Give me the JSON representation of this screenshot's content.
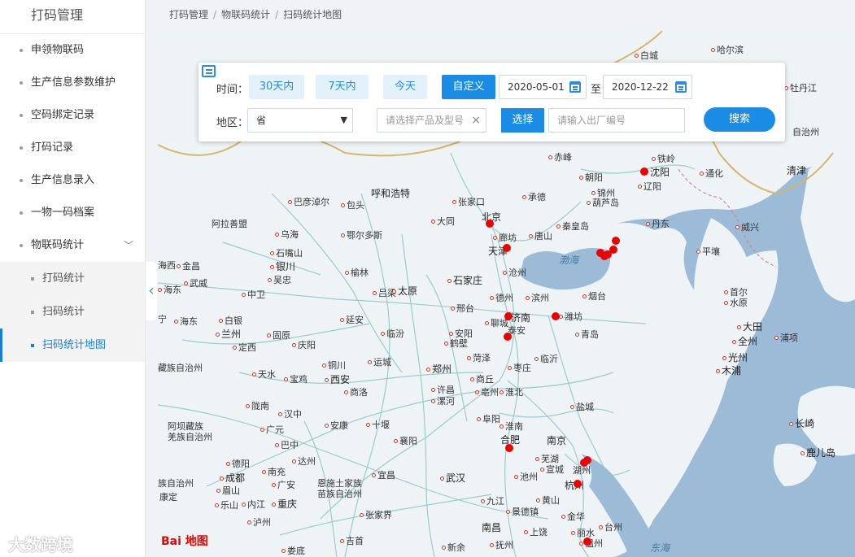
{
  "sidebar": {
    "title": "打码管理",
    "items": [
      {
        "label": "申领物联码"
      },
      {
        "label": "生产信息参数维护"
      },
      {
        "label": "空码绑定记录"
      },
      {
        "label": "打码记录"
      },
      {
        "label": "生产信息录入"
      },
      {
        "label": "一物一码档案"
      },
      {
        "label": "物联码统计"
      }
    ],
    "subitems": [
      {
        "label": "打码统计"
      },
      {
        "label": "扫码统计"
      },
      {
        "label": "扫码统计地图"
      }
    ],
    "collapse_icon": "chevron-left-icon"
  },
  "breadcrumb": [
    "打码管理",
    "物联码统计",
    "扫码统计地图"
  ],
  "breadcrumb_sep": "/",
  "filter": {
    "time_label": "时间：",
    "ranges": [
      "30天内",
      "7天内",
      "今天",
      "自定义"
    ],
    "active_range": "自定义",
    "start_date": "2020-05-01",
    "to_label": "至",
    "end_date": "2020-12-22",
    "region_label": "地区：",
    "region_value": "省",
    "product_placeholder": "请选择产品及型号",
    "select_button": "选择",
    "factory_placeholder": "请输入出厂编号",
    "search_button": "搜索"
  },
  "map": {
    "cities": [
      {
        "name": "白城"
      },
      {
        "name": "哈尔滨"
      },
      {
        "name": "牡丹江"
      },
      {
        "name": "自治州"
      },
      {
        "name": "赤峰"
      },
      {
        "name": "铁岭"
      },
      {
        "name": "沈阳"
      },
      {
        "name": "朝阳"
      },
      {
        "name": "通化"
      },
      {
        "name": "锦州"
      },
      {
        "name": "清津"
      },
      {
        "name": "辽阳"
      },
      {
        "name": "葫芦岛"
      },
      {
        "name": "承德"
      },
      {
        "name": "呼和浩特"
      },
      {
        "name": "巴彦淖尔"
      },
      {
        "name": "包头"
      },
      {
        "name": "张家口"
      },
      {
        "name": "北京"
      },
      {
        "name": "秦皇岛"
      },
      {
        "name": "丹东"
      },
      {
        "name": "威兴"
      },
      {
        "name": "大同"
      },
      {
        "name": "廊坊"
      },
      {
        "name": "唐山"
      },
      {
        "name": "阿拉善盟"
      },
      {
        "name": "乌海"
      },
      {
        "name": "鄂尔多斯"
      },
      {
        "name": "天津"
      },
      {
        "name": "平壤"
      },
      {
        "name": "石嘴山"
      },
      {
        "name": "金昌"
      },
      {
        "name": "银川"
      },
      {
        "name": "沧州"
      },
      {
        "name": "武威"
      },
      {
        "name": "吴忠"
      },
      {
        "name": "榆林"
      },
      {
        "name": "石家庄"
      },
      {
        "name": "首尔"
      },
      {
        "name": "中卫"
      },
      {
        "name": "吕梁"
      },
      {
        "name": "太原"
      },
      {
        "name": "德州"
      },
      {
        "name": "滨州"
      },
      {
        "name": "烟台"
      },
      {
        "name": "水原"
      },
      {
        "name": "海东"
      },
      {
        "name": "白银"
      },
      {
        "name": "延安"
      },
      {
        "name": "邢台"
      },
      {
        "name": "济南"
      },
      {
        "name": "潍坊"
      },
      {
        "name": "大田"
      },
      {
        "name": "兰州"
      },
      {
        "name": "固原"
      },
      {
        "name": "临汾"
      },
      {
        "name": "安阳"
      },
      {
        "name": "聊城"
      },
      {
        "name": "泰安"
      },
      {
        "name": "青岛"
      },
      {
        "name": "全州"
      },
      {
        "name": "浦项"
      },
      {
        "name": "定西"
      },
      {
        "name": "庆阳"
      },
      {
        "name": "鹤壁"
      },
      {
        "name": "光州"
      },
      {
        "name": "铜川"
      },
      {
        "name": "运城"
      },
      {
        "name": "菏泽"
      },
      {
        "name": "临沂"
      },
      {
        "name": "木浦"
      },
      {
        "name": "天水"
      },
      {
        "name": "宝鸡"
      },
      {
        "name": "西安"
      },
      {
        "name": "郑州"
      },
      {
        "name": "商丘"
      },
      {
        "name": "枣庄"
      },
      {
        "name": "陇南"
      },
      {
        "name": "商洛"
      },
      {
        "name": "许昌"
      },
      {
        "name": "亳州"
      },
      {
        "name": "淮北"
      },
      {
        "name": "盐城"
      },
      {
        "name": "汉中"
      },
      {
        "name": "漯河"
      },
      {
        "name": "阜阳"
      },
      {
        "name": "长崎"
      },
      {
        "name": "安康"
      },
      {
        "name": "十堰"
      },
      {
        "name": "淮南"
      },
      {
        "name": "广元"
      },
      {
        "name": "巴中"
      },
      {
        "name": "襄阳"
      },
      {
        "name": "合肥"
      },
      {
        "name": "南京"
      },
      {
        "name": "鹿儿岛"
      },
      {
        "name": "达州"
      },
      {
        "name": "德阳"
      },
      {
        "name": "芜湖"
      },
      {
        "name": "成都"
      },
      {
        "name": "南充"
      },
      {
        "name": "宜昌"
      },
      {
        "name": "武汉"
      },
      {
        "name": "宣城"
      },
      {
        "name": "湖州"
      },
      {
        "name": "池州"
      },
      {
        "name": "广安"
      },
      {
        "name": "杭州"
      },
      {
        "name": "眉山"
      },
      {
        "name": "重庆"
      },
      {
        "name": "九江"
      },
      {
        "name": "黄山"
      },
      {
        "name": "乐山"
      },
      {
        "name": "内江"
      },
      {
        "name": "景德镇"
      },
      {
        "name": "泸州"
      },
      {
        "name": "张家界"
      },
      {
        "name": "金华"
      },
      {
        "name": "南昌"
      },
      {
        "name": "上饶"
      },
      {
        "name": "台州"
      },
      {
        "name": "丽水"
      },
      {
        "name": "吉首"
      },
      {
        "name": "温州"
      },
      {
        "name": "娄底"
      },
      {
        "name": "新余"
      },
      {
        "name": "抚州"
      },
      {
        "name": "康定"
      },
      {
        "name": "海东"
      },
      {
        "name": "宁"
      },
      {
        "name": "海西"
      }
    ],
    "region_labels": [
      {
        "name": "阿坝藏族\n羌族自治州"
      },
      {
        "name": "恩施土家族\n苗族自治州"
      },
      {
        "name": "藏族自治州"
      },
      {
        "name": "族自治州"
      }
    ],
    "seas": [
      "渤海",
      "东海"
    ],
    "logo": "Bai 地图",
    "watermark": "大数跨境"
  }
}
